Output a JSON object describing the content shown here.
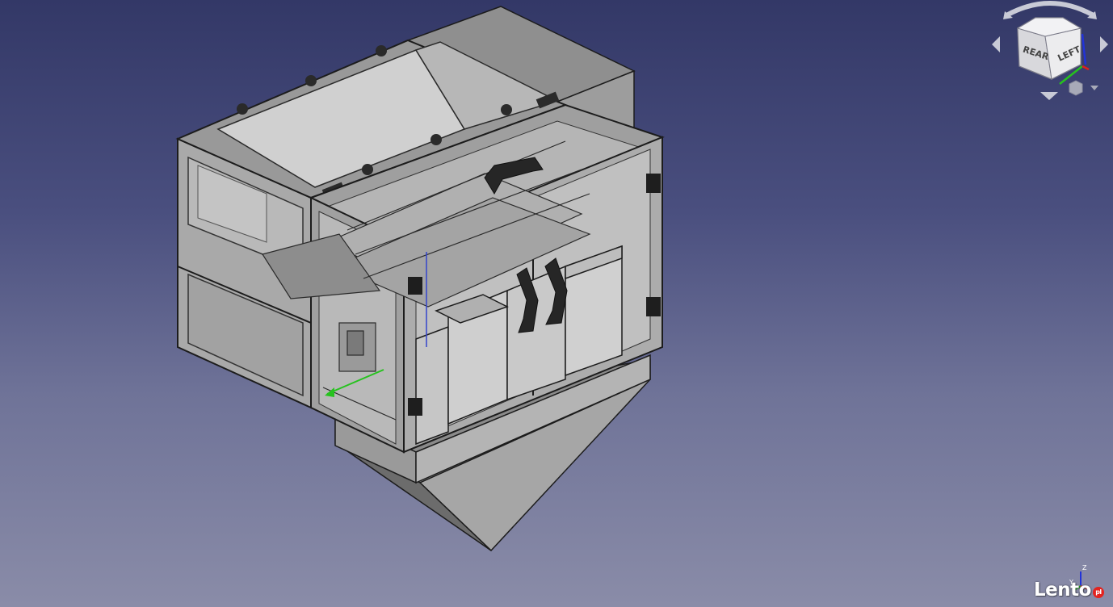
{
  "app": "FreeCAD 3D view",
  "navcube": {
    "face_rear": "REAR",
    "face_left": "LEFT"
  },
  "mini_axis": {
    "z_label": "Z",
    "y_label": "Y"
  },
  "watermark": {
    "brand": "Lento",
    "tld": "pl"
  },
  "colors": {
    "background_top": "#333867",
    "background_bottom": "#8a8ca8",
    "model_frame": "#7d7d7d",
    "model_glass": "#9e9e9e",
    "axis_x": "#e0201c",
    "axis_y": "#26c21e",
    "axis_z": "#2233d8",
    "watermark_dot": "#e3231f"
  }
}
